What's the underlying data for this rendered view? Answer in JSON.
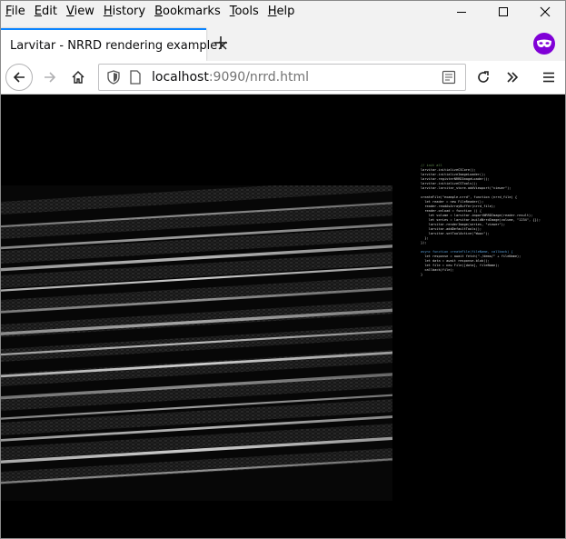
{
  "menubar": {
    "items": [
      {
        "accel": "F",
        "rest": "ile"
      },
      {
        "accel": "E",
        "rest": "dit"
      },
      {
        "accel": "V",
        "rest": "iew"
      },
      {
        "accel": "H",
        "rest": "istory"
      },
      {
        "accel": "B",
        "rest": "ookmarks"
      },
      {
        "accel": "T",
        "rest": "ools"
      },
      {
        "accel": "H",
        "rest": "elp"
      }
    ]
  },
  "tab": {
    "title": "Larvitar - NRRD rendering example"
  },
  "urlbar": {
    "host": "localhost",
    "rest": ":9090/nrrd.html"
  },
  "colors": {
    "accent": "#0a84ff",
    "private": "#8000d7",
    "content_bg": "#000000"
  },
  "code": {
    "lines": [
      {
        "type": "c",
        "text": "// init all"
      },
      {
        "type": "t",
        "text": "larvitar.initializeCSCore();"
      },
      {
        "type": "t",
        "text": "larvitar.initializeImageLoader();"
      },
      {
        "type": "t",
        "text": "larvitar.registerNRRDImageLoader();"
      },
      {
        "type": "t",
        "text": "larvitar.initializeCSTools();"
      },
      {
        "type": "t",
        "text": "larvitar.larvitar_store.addViewport(\"viewer\");"
      },
      {
        "type": "t",
        "text": ""
      },
      {
        "type": "t",
        "text": "createFile(\"example.nrrd\", function (nrrd_file) {"
      },
      {
        "type": "t",
        "text": "  let reader = new FileReader();"
      },
      {
        "type": "t",
        "text": "  reader.readAsArrayBuffer(nrrd_file);"
      },
      {
        "type": "t",
        "text": "  reader.onload = function () {"
      },
      {
        "type": "t",
        "text": "    let volume = larvitar.importNRRDImage(reader.result);"
      },
      {
        "type": "t",
        "text": "    let series = larvitar.buildNrrdImage(volume, \"1234\", {});"
      },
      {
        "type": "t",
        "text": "    larvitar.renderImage(series, \"viewer\");"
      },
      {
        "type": "t",
        "text": "    larvitar.addDefaultTools();"
      },
      {
        "type": "t",
        "text": "    larvitar.setToolActive(\"Wwwc\");"
      },
      {
        "type": "t",
        "text": "  };"
      },
      {
        "type": "t",
        "text": "});"
      },
      {
        "type": "t",
        "text": ""
      },
      {
        "type": "k",
        "text": "async function createFile(fileName, callback) {"
      },
      {
        "type": "t",
        "text": "  let response = await fetch(\"./demo/\" + fileName);"
      },
      {
        "type": "t",
        "text": "  let data = await response.blob();"
      },
      {
        "type": "t",
        "text": "  let file = new File([data], fileName);"
      },
      {
        "type": "t",
        "text": "  callback(file);"
      },
      {
        "type": "t",
        "text": "}"
      }
    ]
  }
}
